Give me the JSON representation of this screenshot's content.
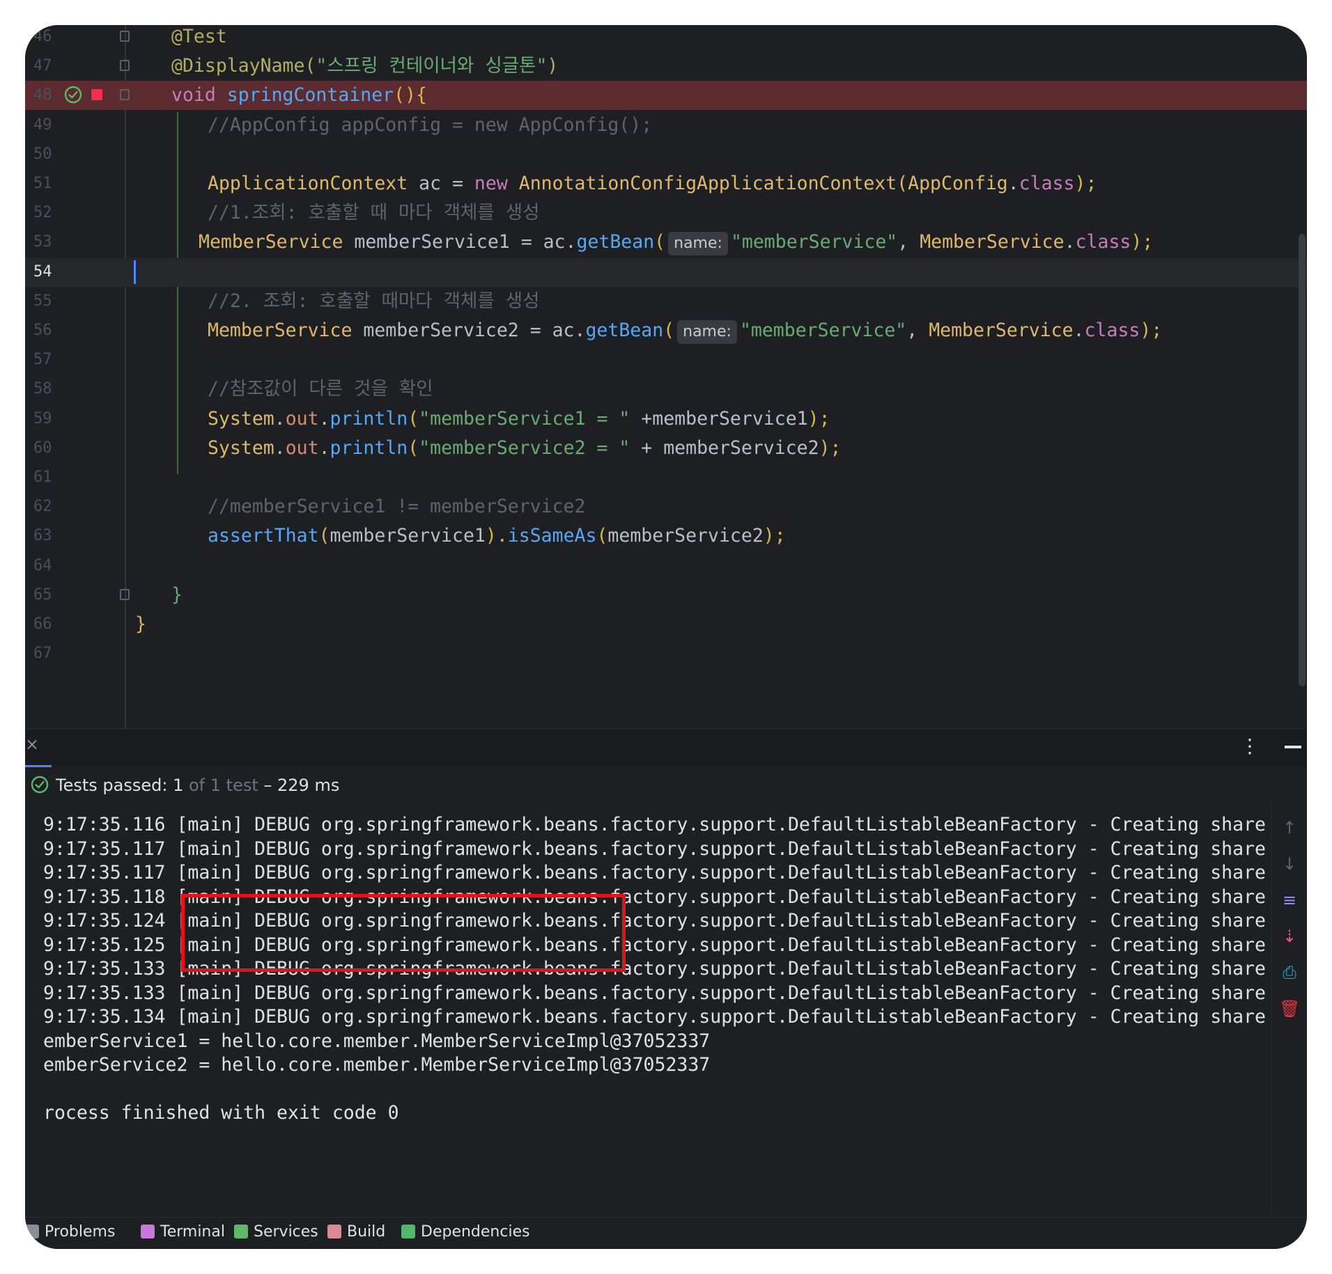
{
  "editor": {
    "lines": [
      {
        "num": "46",
        "parts": [
          {
            "t": "@Test",
            "c": "ann"
          }
        ]
      },
      {
        "num": "47",
        "parts": [
          {
            "t": "@DisplayName(",
            "c": "ann"
          },
          {
            "t": "\"스프링 컨테이너와 싱글톤\"",
            "c": "str"
          },
          {
            "t": ")",
            "c": "ann"
          }
        ]
      },
      {
        "num": "48",
        "parts": [
          {
            "t": "void ",
            "c": "kw2"
          },
          {
            "t": "springContainer",
            "c": "fn"
          },
          {
            "t": "(){",
            "c": "paren"
          }
        ]
      },
      {
        "num": "49",
        "parts": [
          {
            "t": "//AppConfig appConfig = new AppConfig();",
            "c": "cm"
          }
        ]
      },
      {
        "num": "50",
        "parts": []
      },
      {
        "num": "51",
        "parts": [
          {
            "t": "ApplicationContext",
            "c": "cls"
          },
          {
            "t": " ac = ",
            "c": ""
          },
          {
            "t": "new ",
            "c": "kw2"
          },
          {
            "t": "AnnotationConfigApplicationContext(AppConfig",
            "c": "cls"
          },
          {
            "t": ".",
            "c": ""
          },
          {
            "t": "class",
            "c": "kw2"
          },
          {
            "t": ");",
            "c": "paren"
          }
        ]
      },
      {
        "num": "52",
        "parts": [
          {
            "t": "//1.조회: 호출할 때 마다 객체를 생성",
            "c": "cm"
          }
        ]
      },
      {
        "num": "53",
        "parts": [
          {
            "t": "MemberService",
            "c": "cls"
          },
          {
            "t": " memberService1 = ac.",
            "c": ""
          },
          {
            "t": "getBean",
            "c": "fn"
          },
          {
            "t": "(",
            "c": "paren"
          },
          {
            "t": "name:",
            "c": "hint"
          },
          {
            "t": "\"memberService\"",
            "c": "str"
          },
          {
            "t": ", ",
            "c": ""
          },
          {
            "t": "MemberService",
            "c": "cls"
          },
          {
            "t": ".",
            "c": ""
          },
          {
            "t": "class",
            "c": "kw2"
          },
          {
            "t": ");",
            "c": "paren"
          }
        ]
      },
      {
        "num": "54",
        "parts": []
      },
      {
        "num": "55",
        "parts": [
          {
            "t": "//2. 조회: 호출할 때마다 객체를 생성",
            "c": "cm"
          }
        ]
      },
      {
        "num": "56",
        "parts": [
          {
            "t": "MemberService",
            "c": "cls"
          },
          {
            "t": " memberService2 = ac.",
            "c": ""
          },
          {
            "t": "getBean",
            "c": "fn"
          },
          {
            "t": "(",
            "c": "paren"
          },
          {
            "t": "name:",
            "c": "hint"
          },
          {
            "t": "\"memberService\"",
            "c": "str"
          },
          {
            "t": ", ",
            "c": ""
          },
          {
            "t": "MemberService",
            "c": "cls"
          },
          {
            "t": ".",
            "c": ""
          },
          {
            "t": "class",
            "c": "kw2"
          },
          {
            "t": ");",
            "c": "paren"
          }
        ]
      },
      {
        "num": "57",
        "parts": []
      },
      {
        "num": "58",
        "parts": [
          {
            "t": "//참조값이 다른 것을 확인",
            "c": "cm"
          }
        ]
      },
      {
        "num": "59",
        "parts": [
          {
            "t": "System",
            "c": "cls"
          },
          {
            "t": ".",
            "c": ""
          },
          {
            "t": "out",
            "c": "kw"
          },
          {
            "t": ".",
            "c": ""
          },
          {
            "t": "println",
            "c": "fn"
          },
          {
            "t": "(",
            "c": "paren"
          },
          {
            "t": "\"memberService1 = \"",
            "c": "str"
          },
          {
            "t": " +memberService1",
            "c": ""
          },
          {
            "t": ");",
            "c": "paren"
          }
        ]
      },
      {
        "num": "60",
        "parts": [
          {
            "t": "System",
            "c": "cls"
          },
          {
            "t": ".",
            "c": ""
          },
          {
            "t": "out",
            "c": "kw"
          },
          {
            "t": ".",
            "c": ""
          },
          {
            "t": "println",
            "c": "fn"
          },
          {
            "t": "(",
            "c": "paren"
          },
          {
            "t": "\"memberService2 = \"",
            "c": "str"
          },
          {
            "t": " + memberService2",
            "c": ""
          },
          {
            "t": ");",
            "c": "paren"
          }
        ]
      },
      {
        "num": "61",
        "parts": []
      },
      {
        "num": "62",
        "parts": [
          {
            "t": "//memberService1 != memberService2",
            "c": "cm"
          }
        ]
      },
      {
        "num": "63",
        "parts": [
          {
            "t": "assertThat",
            "c": "fn"
          },
          {
            "t": "(",
            "c": "paren"
          },
          {
            "t": "memberService1",
            "c": ""
          },
          {
            "t": ").",
            "c": "paren"
          },
          {
            "t": "isSameAs",
            "c": "fn"
          },
          {
            "t": "(",
            "c": "paren"
          },
          {
            "t": "memberService2",
            "c": ""
          },
          {
            "t": ");",
            "c": "paren"
          }
        ]
      },
      {
        "num": "64",
        "parts": []
      },
      {
        "num": "65",
        "parts": [
          {
            "t": "}",
            "c": "str"
          }
        ]
      },
      {
        "num": "66",
        "parts": [
          {
            "t": "}",
            "c": "paren"
          }
        ]
      },
      {
        "num": "67",
        "parts": []
      }
    ]
  },
  "run_panel": {
    "close_glyph": "×",
    "more_glyph": "⋮",
    "status": {
      "label": "Tests passed:",
      "count": "1",
      "of_text": "of 1 test",
      "duration": "– 229 ms"
    },
    "console_lines": [
      "9:17:35.116 [main] DEBUG org.springframework.beans.factory.support.DefaultListableBeanFactory - Creating share",
      "9:17:35.117 [main] DEBUG org.springframework.beans.factory.support.DefaultListableBeanFactory - Creating share",
      "9:17:35.117 [main] DEBUG org.springframework.beans.factory.support.DefaultListableBeanFactory - Creating share",
      "9:17:35.118 [main] DEBUG org.springframework.beans.factory.support.DefaultListableBeanFactory - Creating share",
      "9:17:35.124 [main] DEBUG org.springframework.beans.factory.support.DefaultListableBeanFactory - Creating share",
      "9:17:35.125 [main] DEBUG org.springframework.beans.factory.support.DefaultListableBeanFactory - Creating share",
      "9:17:35.133 [main] DEBUG org.springframework.beans.factory.support.DefaultListableBeanFactory - Creating share",
      "9:17:35.133 [main] DEBUG org.springframework.beans.factory.support.DefaultListableBeanFactory - Creating share",
      "9:17:35.134 [main] DEBUG org.springframework.beans.factory.support.DefaultListableBeanFactory - Creating share",
      "emberService1 = hello.core.member.MemberServiceImpl@37052337",
      "emberService2 = hello.core.member.MemberServiceImpl@37052337",
      "",
      "rocess finished with exit code 0"
    ],
    "tools": [
      {
        "name": "scroll-up-icon",
        "glyph": "↑",
        "color": "#5f636b"
      },
      {
        "name": "scroll-down-icon",
        "glyph": "↓",
        "color": "#5f636b"
      },
      {
        "name": "soft-wrap-icon",
        "glyph": "≡",
        "color": "#8b8ff7"
      },
      {
        "name": "scroll-to-end-icon",
        "glyph": "⇣",
        "color": "#f2557a"
      },
      {
        "name": "print-icon",
        "glyph": "⎙",
        "color": "#27a9c9"
      },
      {
        "name": "trash-icon",
        "glyph": "🗑",
        "color": "#e5333f"
      }
    ]
  },
  "bottom_bar": {
    "tabs": [
      {
        "name": "tab-problems",
        "label": "Problems",
        "icon": "problems-icon",
        "color": "#8a8d93"
      },
      {
        "name": "tab-terminal",
        "label": "Terminal",
        "icon": "terminal-icon",
        "color": "#c678dd"
      },
      {
        "name": "tab-services",
        "label": "Services",
        "icon": "gear-icon",
        "color": "#5fb865"
      },
      {
        "name": "tab-build",
        "label": "Build",
        "icon": "hammer-icon",
        "color": "#d98a93"
      },
      {
        "name": "tab-dependencies",
        "label": "Dependencies",
        "icon": "dependencies-icon",
        "color": "#4fb86a"
      }
    ]
  },
  "colors": {
    "accent": "#4a88f7",
    "error_line": "#5c2b2f",
    "highlight_box": "#e3131b",
    "pass_green": "#5fb865"
  }
}
